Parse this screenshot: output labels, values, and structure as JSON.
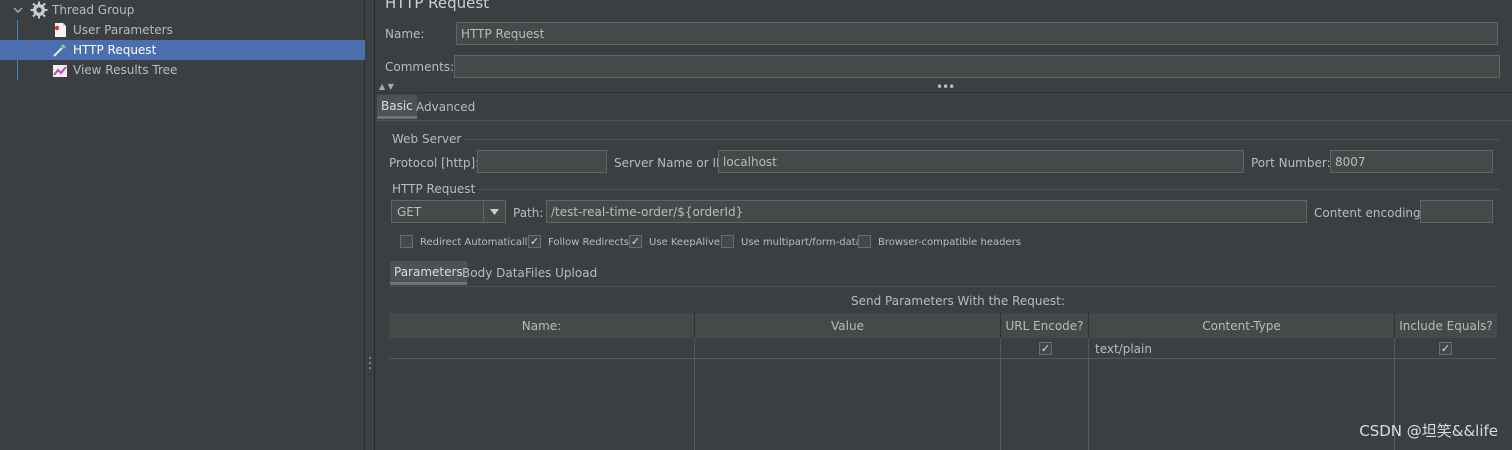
{
  "tree": {
    "items": [
      {
        "label": "Thread Group"
      },
      {
        "label": "User Parameters"
      },
      {
        "label": "HTTP Request"
      },
      {
        "label": "View Results Tree"
      }
    ]
  },
  "header": {
    "title": "HTTP Request",
    "name_label": "Name:",
    "name_value": "HTTP Request",
    "comments_label": "Comments:",
    "comments_value": ""
  },
  "tabs": {
    "basic": "Basic",
    "advanced": "Advanced"
  },
  "web_server": {
    "title": "Web Server",
    "protocol_label": "Protocol [http]:",
    "protocol_value": "",
    "server_label": "Server Name or IP:",
    "server_value": "localhost",
    "port_label": "Port Number:",
    "port_value": "8007"
  },
  "http_request": {
    "title": "HTTP Request",
    "method": "GET",
    "path_label": "Path:",
    "path_value": "/test-real-time-order/${orderId}",
    "encoding_label": "Content encoding:",
    "encoding_value": ""
  },
  "options": [
    {
      "label": "Redirect Automatically",
      "checked": false
    },
    {
      "label": "Follow Redirects",
      "checked": true
    },
    {
      "label": "Use KeepAlive",
      "checked": true
    },
    {
      "label": "Use multipart/form-data",
      "checked": false
    },
    {
      "label": "Browser-compatible headers",
      "checked": false
    }
  ],
  "subtabs": {
    "parameters": "Parameters",
    "body": "Body Data",
    "files": "Files Upload"
  },
  "params_table": {
    "caption": "Send Parameters With the Request:",
    "columns": [
      "Name:",
      "Value",
      "URL Encode?",
      "Content-Type",
      "Include Equals?"
    ],
    "rows": [
      {
        "name": "",
        "value": "",
        "url_encode": true,
        "content_type": "text/plain",
        "include_equals": true
      }
    ]
  },
  "watermark": "CSDN @坦笑&&life"
}
